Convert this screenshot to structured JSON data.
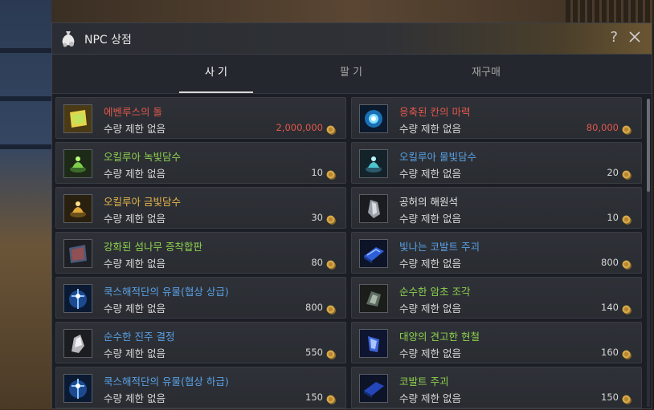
{
  "window": {
    "title": "NPC 상점"
  },
  "header": {
    "help": "?"
  },
  "tabs": [
    {
      "label": "사 기",
      "active": true
    },
    {
      "label": "팔 기",
      "active": false
    },
    {
      "label": "재구매",
      "active": false
    }
  ],
  "items": [
    {
      "name": "에벤루스의 돌",
      "limit": "수량 제한 없음",
      "price": "2,000,000",
      "name_color": "#e2574c",
      "price_color": "#e2574c",
      "icon": "yellow-stone-icon"
    },
    {
      "name": "응축된 칸의 마력",
      "limit": "수량 제한 없음",
      "price": "80,000",
      "name_color": "#e2574c",
      "price_color": "#e2574c",
      "icon": "blue-orb-icon"
    },
    {
      "name": "오킬루아 녹빛담수",
      "limit": "수량 제한 없음",
      "price": "10",
      "name_color": "#8fd14f",
      "price_color": "#d8d8d8",
      "icon": "green-potion-icon"
    },
    {
      "name": "오킬루아 물빛담수",
      "limit": "수량 제한 없음",
      "price": "20",
      "name_color": "#5aa0e6",
      "price_color": "#d8d8d8",
      "icon": "cyan-potion-icon"
    },
    {
      "name": "오킬루아 금빛담수",
      "limit": "수량 제한 없음",
      "price": "30",
      "name_color": "#e8b64a",
      "price_color": "#d8d8d8",
      "icon": "gold-potion-icon"
    },
    {
      "name": "공허의 해원석",
      "limit": "수량 제한 없음",
      "price": "10",
      "name_color": "#e6e6e6",
      "price_color": "#d8d8d8",
      "icon": "gray-crystal-icon"
    },
    {
      "name": "강화된 섬나무 증착합판",
      "limit": "수량 제한 없음",
      "price": "80",
      "name_color": "#8fd14f",
      "price_color": "#d8d8d8",
      "icon": "wood-plank-icon"
    },
    {
      "name": "빛나는 코발트 주괴",
      "limit": "수량 제한 없음",
      "price": "800",
      "name_color": "#5aa0e6",
      "price_color": "#d8d8d8",
      "icon": "blue-ingot-icon"
    },
    {
      "name": "쿡스해적단의 유물(협상 상급)",
      "limit": "수량 제한 없음",
      "price": "800",
      "name_color": "#5aa0e6",
      "price_color": "#d8d8d8",
      "icon": "relic-icon"
    },
    {
      "name": "순수한 암초 조각",
      "limit": "수량 제한 없음",
      "price": "140",
      "name_color": "#8fd14f",
      "price_color": "#d8d8d8",
      "icon": "reef-shard-icon"
    },
    {
      "name": "순수한 진주 결정",
      "limit": "수량 제한 없음",
      "price": "550",
      "name_color": "#5aa0e6",
      "price_color": "#d8d8d8",
      "icon": "pearl-crystal-icon"
    },
    {
      "name": "대양의 견고한 현철",
      "limit": "수량 제한 없음",
      "price": "160",
      "name_color": "#8fd14f",
      "price_color": "#d8d8d8",
      "icon": "ocean-iron-icon"
    },
    {
      "name": "쿡스해적단의 유물(협상 하급)",
      "limit": "수량 제한 없음",
      "price": "150",
      "name_color": "#5aa0e6",
      "price_color": "#d8d8d8",
      "icon": "relic-icon"
    },
    {
      "name": "코발트 주괴",
      "limit": "수량 제한 없음",
      "price": "150",
      "name_color": "#8fd14f",
      "price_color": "#d8d8d8",
      "icon": "cobalt-ingot-icon"
    }
  ]
}
